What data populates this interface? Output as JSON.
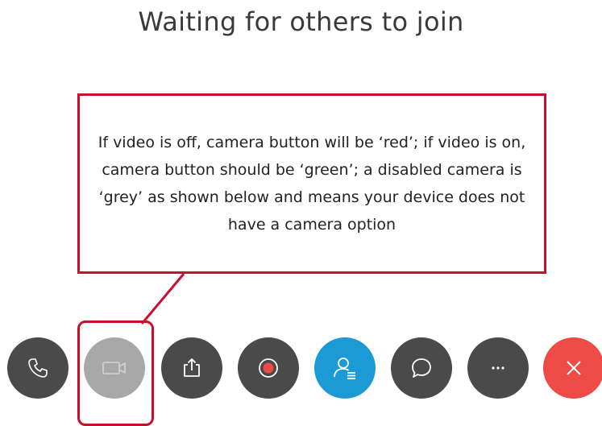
{
  "header": {
    "title": "Waiting for others to join"
  },
  "callout": {
    "text": "If video is off, camera button will be ‘red’; if video is on, camera button should be ‘green’; a disabled camera is ‘grey’ as shown below and means your device does not have a camera option",
    "border_color": "#c8102e"
  },
  "toolbar": {
    "buttons": [
      {
        "icon": "phone-icon",
        "color": "#4a4a4a"
      },
      {
        "icon": "camera-icon",
        "color": "#a8a8a8",
        "state": "disabled"
      },
      {
        "icon": "share-icon",
        "color": "#4a4a4a"
      },
      {
        "icon": "record-icon",
        "color": "#4a4a4a"
      },
      {
        "icon": "participants-icon",
        "color": "#1c9ad6"
      },
      {
        "icon": "chat-icon",
        "color": "#4a4a4a"
      },
      {
        "icon": "more-icon",
        "color": "#4a4a4a"
      },
      {
        "icon": "close-icon",
        "color": "#ee4b47"
      }
    ]
  }
}
